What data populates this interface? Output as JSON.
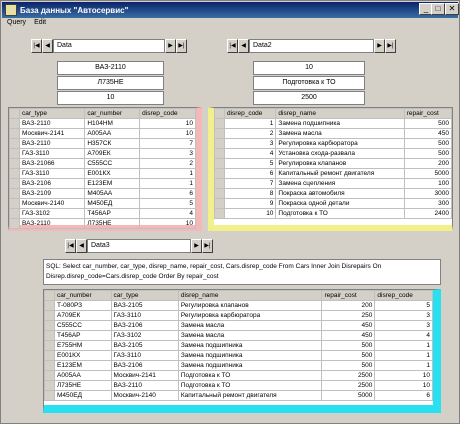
{
  "window": {
    "title": "База данных \"Автосервис\""
  },
  "menu": [
    "Query",
    "Edit"
  ],
  "nav1": {
    "label": "Data"
  },
  "nav2": {
    "label": "Data2"
  },
  "nav3": {
    "label": "Data3"
  },
  "fields_left": [
    "ВАЗ-2110",
    "Л735НЕ",
    "10"
  ],
  "fields_right": [
    "10",
    "Подготовка к ТО",
    "2500"
  ],
  "grid1": {
    "headers": [
      "car_type",
      "car_number",
      "disrep_code"
    ],
    "rows": [
      [
        "ВАЗ-2110",
        "Н104НМ",
        "10"
      ],
      [
        "Москвич-2141",
        "А005АА",
        "10"
      ],
      [
        "ВАЗ-2110",
        "Н357СК",
        "7"
      ],
      [
        "ГАЗ-3110",
        "А709ЕК",
        "3"
      ],
      [
        "ВАЗ-21066",
        "С555СС",
        "2"
      ],
      [
        "ГАЗ-3110",
        "Е001КХ",
        "1"
      ],
      [
        "ВАЗ-2106",
        "Е123ЕМ",
        "1"
      ],
      [
        "ВАЗ-2109",
        "М405АА",
        "6"
      ],
      [
        "Москвич-2140",
        "М450ЕД",
        "5"
      ],
      [
        "ГАЗ-3102",
        "Т456АР",
        "4"
      ],
      [
        "ВАЗ-2110",
        "Л735НЕ",
        "10"
      ]
    ]
  },
  "grid2": {
    "headers": [
      "disrep_code",
      "disrep_name",
      "repair_cost"
    ],
    "rows": [
      [
        "1",
        "Замена подшипника",
        "500"
      ],
      [
        "2",
        "Замена масла",
        "450"
      ],
      [
        "3",
        "Регулировка карбюратора",
        "500"
      ],
      [
        "4",
        "Установка схода-развала",
        "500"
      ],
      [
        "5",
        "Регулировка клапанов",
        "200"
      ],
      [
        "6",
        "Капитальный ремонт двигателя",
        "5000"
      ],
      [
        "7",
        "Замена сцепления",
        "100"
      ],
      [
        "8",
        "Покраска автомобиля",
        "3000"
      ],
      [
        "9",
        "Покраска одной детали",
        "300"
      ],
      [
        "10",
        "Подготовка к ТО",
        "2400"
      ]
    ]
  },
  "sql": "SQL: Select car_number, car_type, disrep_name, repair_cost, Cars.disrep_code From Cars Inner Join Disrepairs On Disrep.disrep_code=Cars.disrep_code Order By repair_cost",
  "grid3": {
    "headers": [
      "car_number",
      "car_type",
      "disrep_name",
      "repair_cost",
      "disrep_code"
    ],
    "rows": [
      [
        "Т-080РЗ",
        "ВАЗ-2105",
        "Регулировка клапанов",
        "200",
        "5"
      ],
      [
        "А709ЕК",
        "ГАЗ-3110",
        "Регулировка карбюратора",
        "250",
        "3"
      ],
      [
        "С555СС",
        "ВАЗ-2106",
        "Замена масла",
        "450",
        "3"
      ],
      [
        "Т456АР",
        "ГАЗ-3102",
        "Замена масла",
        "450",
        "4"
      ],
      [
        "Е755НМ",
        "ВАЗ-2105",
        "Замена подшипника",
        "500",
        "1"
      ],
      [
        "Е001КХ",
        "ГАЗ-3110",
        "Замена подшипника",
        "500",
        "1"
      ],
      [
        "Е123ЕМ",
        "ВАЗ-2106",
        "Замена подшипника",
        "500",
        "1"
      ],
      [
        "А005АА",
        "Москвич-2141",
        "Подготовка к ТО",
        "2500",
        "10"
      ],
      [
        "Л735НЕ",
        "ВАЗ-2110",
        "Подготовка к ТО",
        "2500",
        "10"
      ],
      [
        "М450ЕД",
        "Москвич-2140",
        "Капитальный ремонт двигателя",
        "5000",
        "6"
      ]
    ]
  },
  "colors": {
    "grid1_border": "#f4b8b8",
    "grid2_border": "#f2f08a",
    "grid3_border": "#28e0f0",
    "title_bg": "#0a246a"
  },
  "icons": [
    "first-icon",
    "prev-icon",
    "next-icon",
    "last-icon",
    "minimize-icon",
    "maximize-icon",
    "close-icon"
  ]
}
